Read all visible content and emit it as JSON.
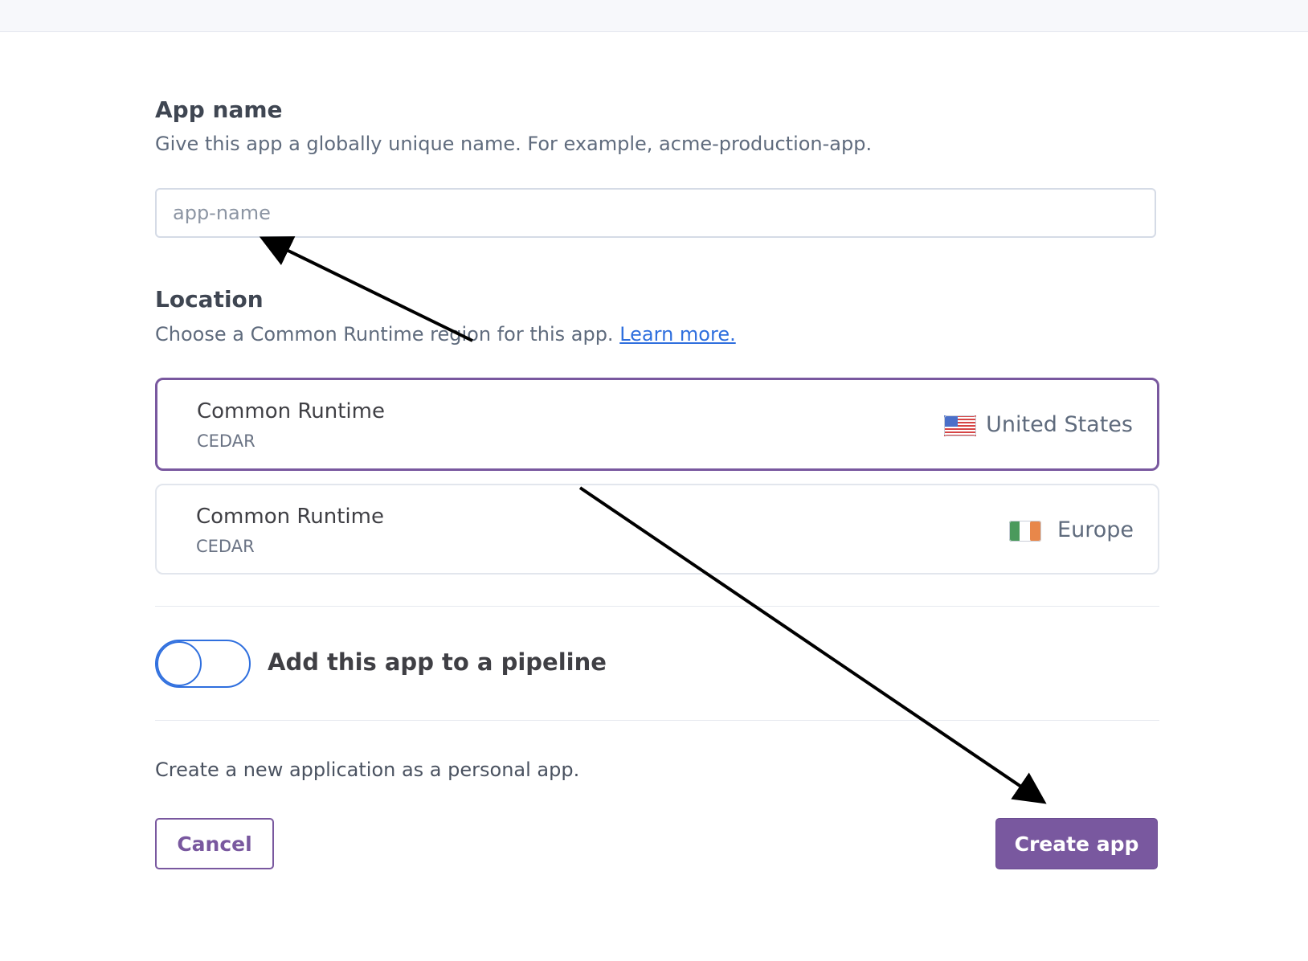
{
  "app_name": {
    "title": "App name",
    "description": "Give this app a globally unique name. For example, acme-production-app.",
    "placeholder": "app-name"
  },
  "location": {
    "title": "Location",
    "description": "Choose a Common Runtime region for this app.",
    "learn_more": "Learn more.",
    "regions": [
      {
        "name": "Common Runtime",
        "code": "CEDAR",
        "location": "United States",
        "flag_icon": "us-flag-icon",
        "selected": true
      },
      {
        "name": "Common Runtime",
        "code": "CEDAR",
        "location": "Europe",
        "flag_icon": "ireland-flag-icon",
        "selected": false
      }
    ]
  },
  "pipeline": {
    "label": "Add this app to a pipeline",
    "enabled": false
  },
  "footer": {
    "note": "Create a new application as a personal app.",
    "cancel_label": "Cancel",
    "create_label": "Create app"
  },
  "colors": {
    "accent_purple": "#79589f",
    "link_blue": "#2f6fde",
    "text_dark": "#3f3f44",
    "text_muted": "#5f6b7d"
  }
}
